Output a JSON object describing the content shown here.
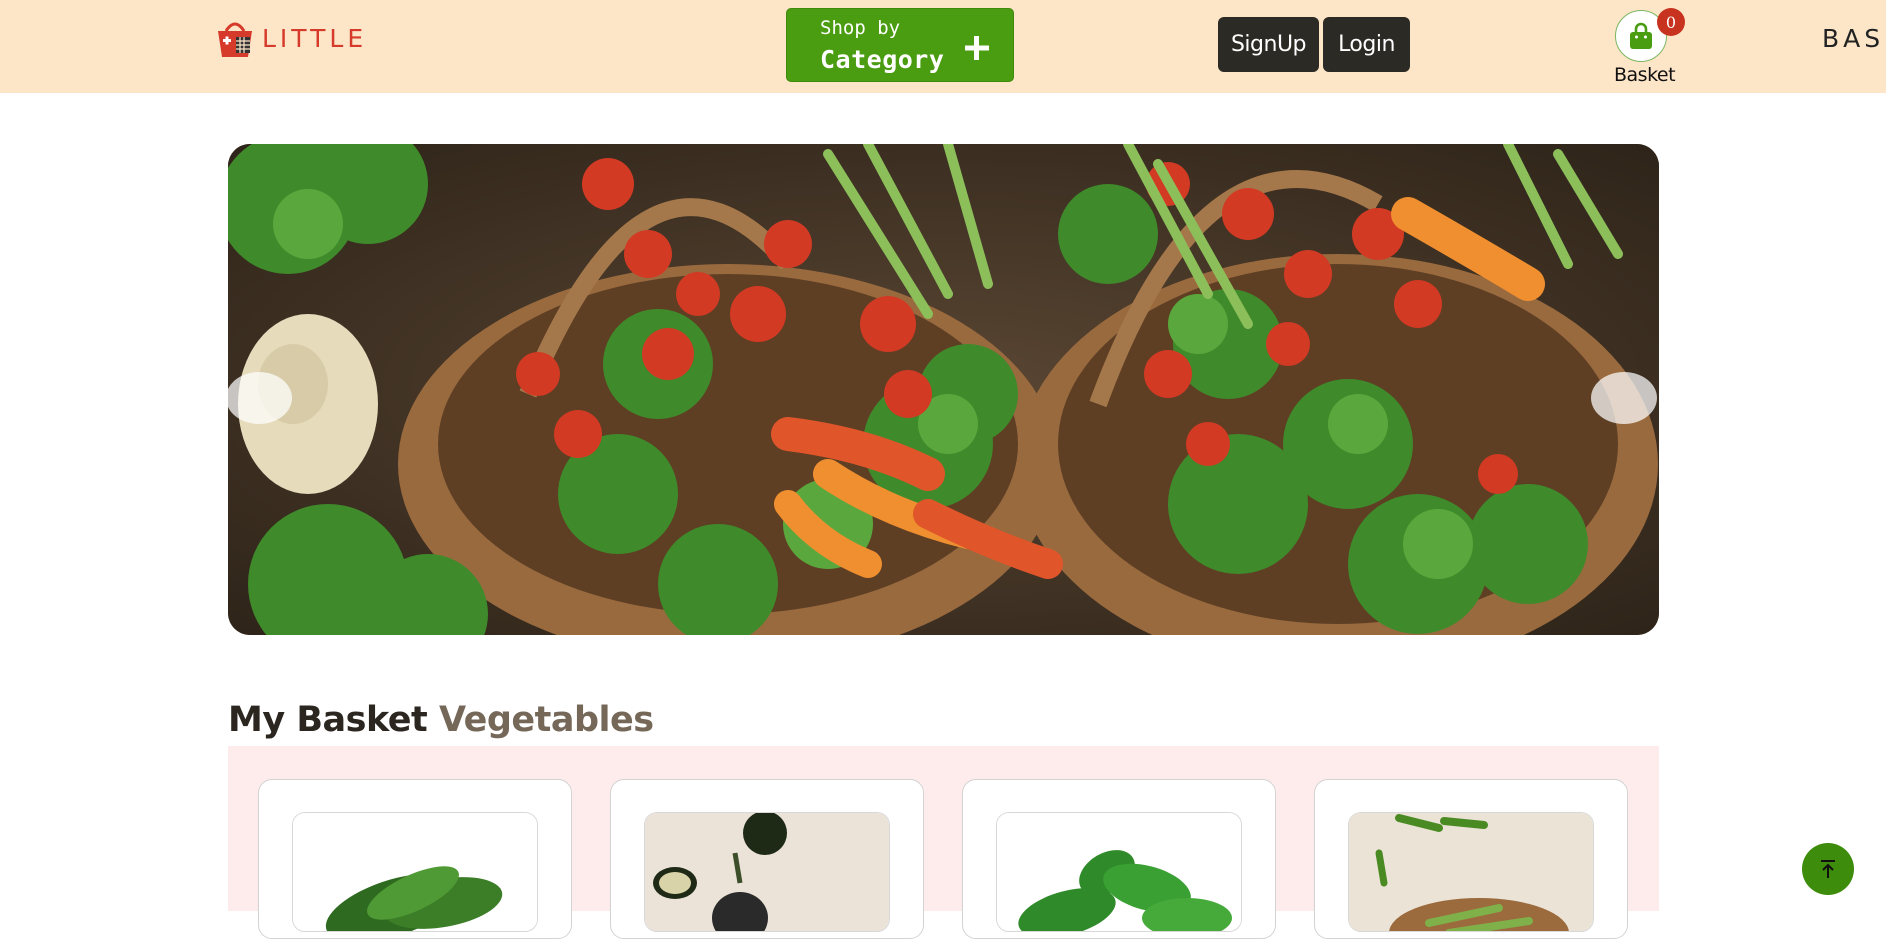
{
  "header": {
    "logo_part1": "LITTLE",
    "logo_part2": "BASKET",
    "shop_by_small": "Shop by",
    "shop_by_big": "Category",
    "signup_label": "SignUp",
    "login_label": "Login",
    "basket_label": "Basket",
    "basket_count": "0"
  },
  "hero": {
    "image": "vegetable-baskets-banner"
  },
  "section": {
    "title_part1": "My Basket",
    "title_part2": "Vegetables"
  },
  "products": [
    {
      "image": "cucumber"
    },
    {
      "image": "eggplant-zucchini"
    },
    {
      "image": "spinach"
    },
    {
      "image": "okra"
    }
  ],
  "colors": {
    "header_bg": "#fde6c8",
    "accent_green": "#4a9c10",
    "dark_button": "#2b2a24",
    "badge_red": "#c8331f",
    "products_bg": "#fdeceb"
  },
  "icons": {
    "logo": "basket-logo-icon",
    "plus": "plus-icon",
    "basket": "shopping-bag-icon",
    "prev": "carousel-prev",
    "next": "carousel-next",
    "scroll_top": "arrow-up-icon"
  }
}
